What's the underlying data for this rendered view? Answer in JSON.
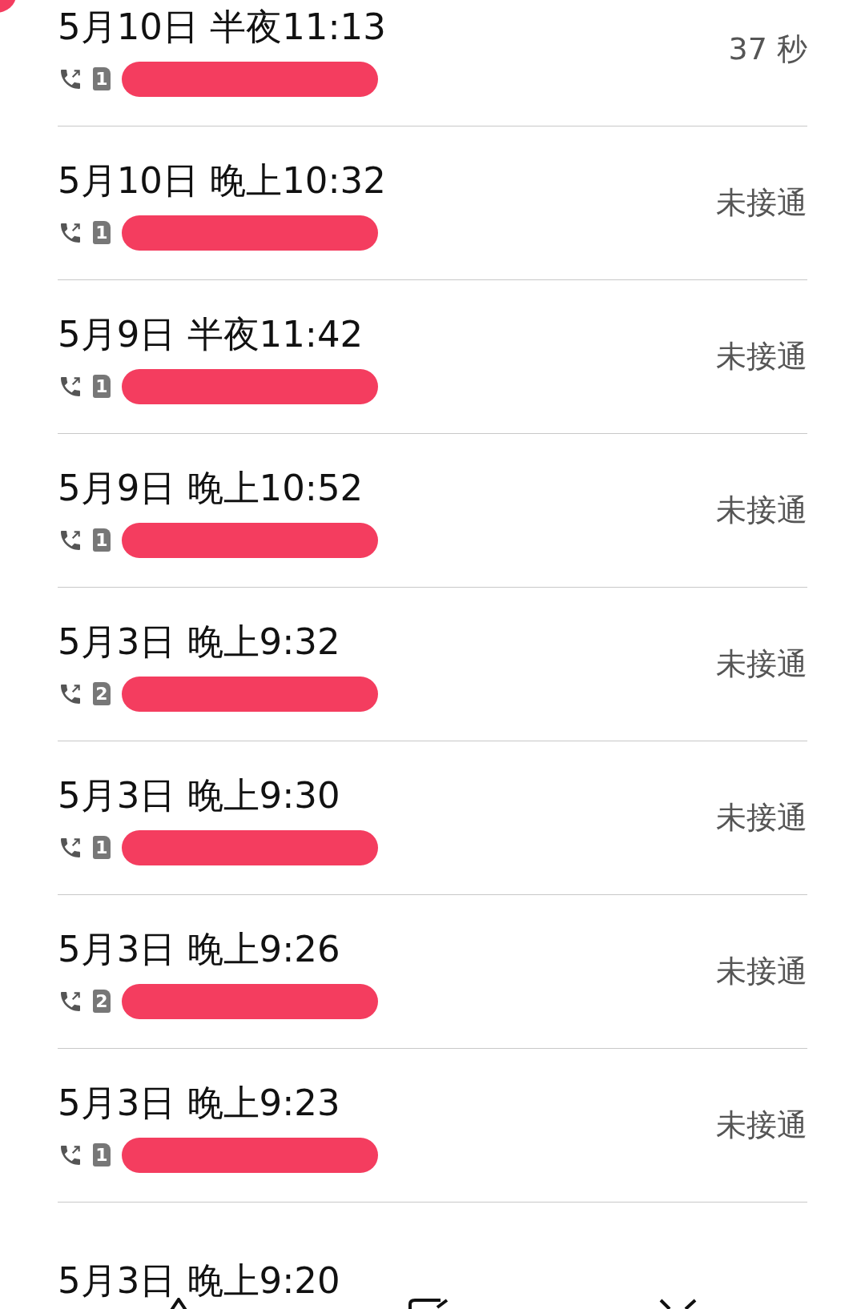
{
  "call_log": [
    {
      "date_time": "5月10日 半夜11:13",
      "sim": "1",
      "status": "37 秒",
      "redacted": true
    },
    {
      "date_time": "5月10日 晚上10:32",
      "sim": "1",
      "status": "未接通",
      "redacted": true
    },
    {
      "date_time": "5月9日 半夜11:42",
      "sim": "1",
      "status": "未接通",
      "redacted": true
    },
    {
      "date_time": "5月9日 晚上10:52",
      "sim": "1",
      "status": "未接通",
      "redacted": true
    },
    {
      "date_time": "5月3日 晚上9:32",
      "sim": "2",
      "status": "未接通",
      "redacted": true
    },
    {
      "date_time": "5月3日 晚上9:30",
      "sim": "1",
      "status": "未接通",
      "redacted": true
    },
    {
      "date_time": "5月3日 晚上9:26",
      "sim": "2",
      "status": "未接通",
      "redacted": true
    },
    {
      "date_time": "5月3日 晚上9:23",
      "sim": "1",
      "status": "未接通",
      "redacted": true
    },
    {
      "date_time": "5月3日 晚上9:20",
      "redacted": false
    }
  ]
}
